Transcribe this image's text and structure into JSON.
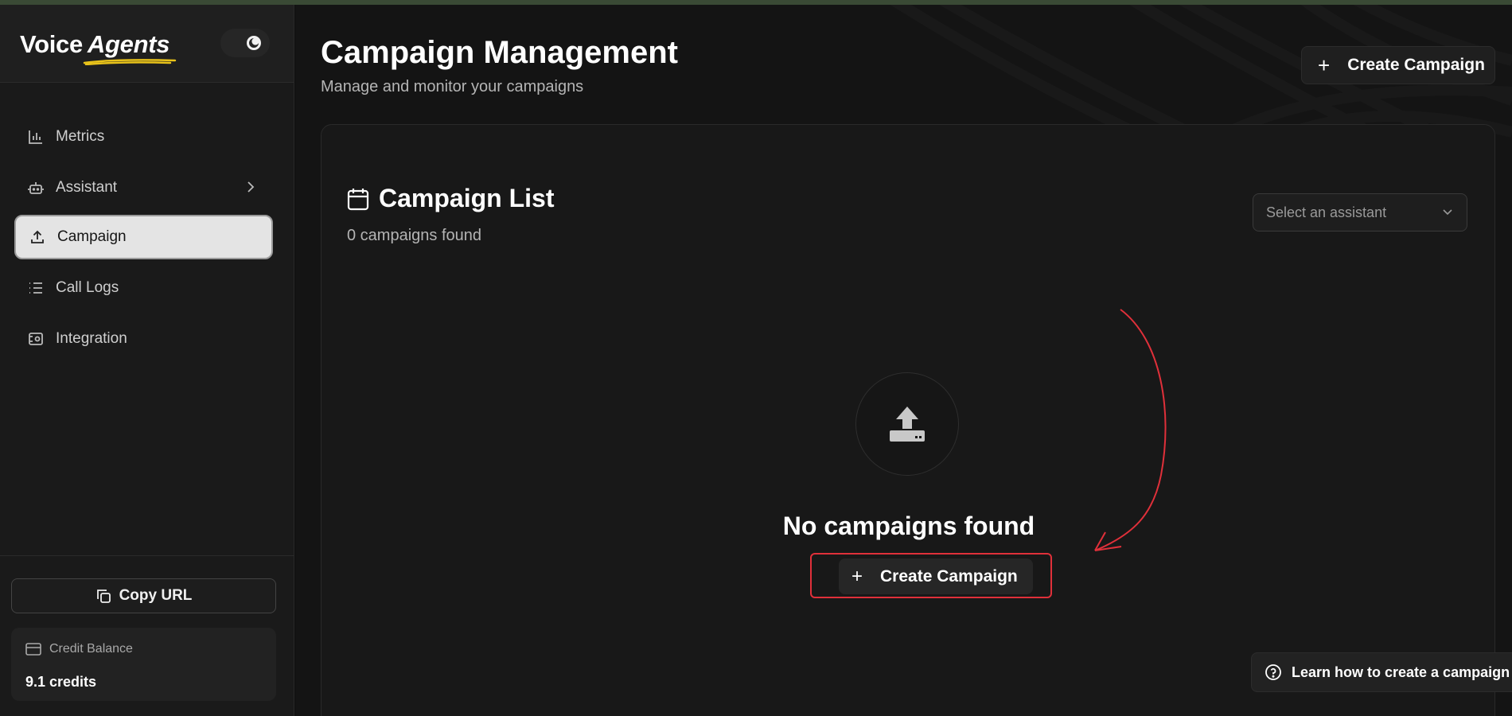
{
  "brand": {
    "word1": "Voice",
    "word2": "Agents"
  },
  "sidebar": {
    "items": [
      {
        "label": "Metrics",
        "icon": "bar-chart-icon"
      },
      {
        "label": "Assistant",
        "icon": "bot-icon"
      },
      {
        "label": "Campaign",
        "icon": "upload-icon",
        "active": true
      },
      {
        "label": "Call Logs",
        "icon": "list-icon"
      },
      {
        "label": "Integration",
        "icon": "integration-icon"
      }
    ],
    "copy_url": "Copy URL",
    "credit_label": "Credit Balance",
    "credit_value": "9.1 credits"
  },
  "header": {
    "title": "Campaign Management",
    "subtitle": "Manage and monitor your campaigns",
    "create_label": "Create Campaign"
  },
  "panel": {
    "title": "Campaign List",
    "count": "0 campaigns found",
    "select_placeholder": "Select an assistant",
    "empty_title": "No campaigns found",
    "empty_create_label": "Create Campaign",
    "learn_label": "Learn how to create a campaign"
  },
  "colors": {
    "accent_red": "#e0303a",
    "active_nav_bg": "#e4e4e4"
  }
}
